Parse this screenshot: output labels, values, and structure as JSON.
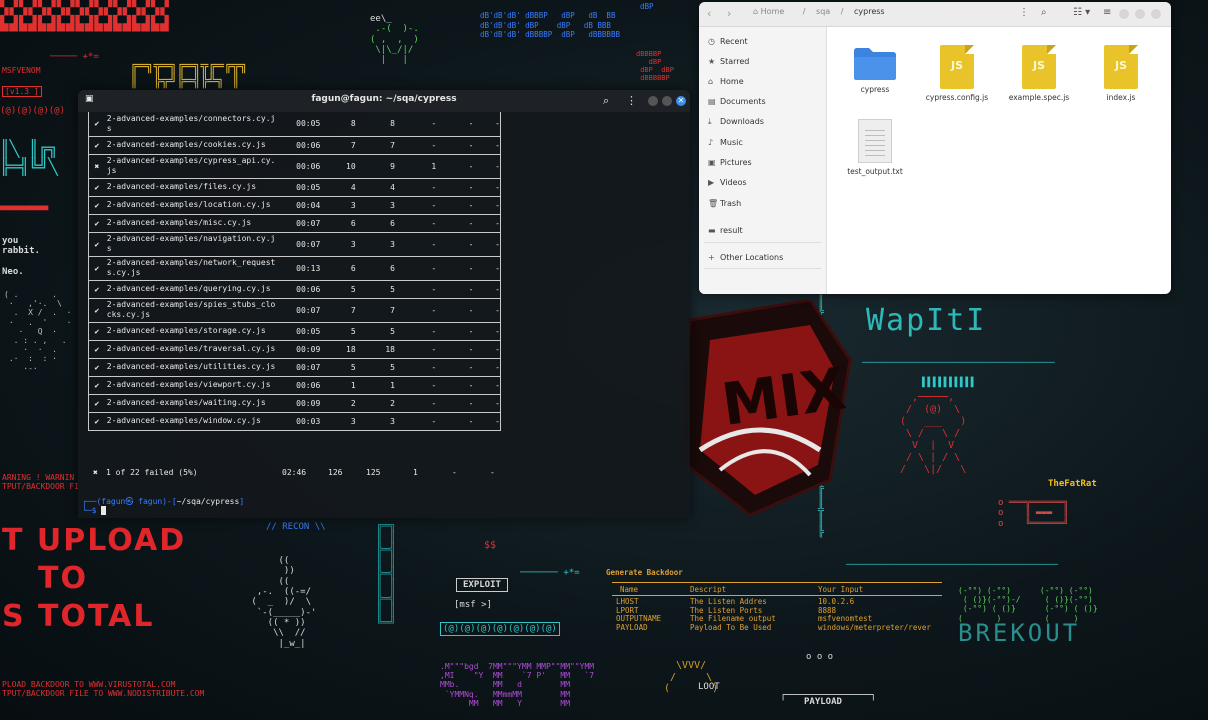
{
  "wallpaper": {
    "msfvenom_label": "MSFVENOM",
    "version_label": "[v1.3 ]",
    "rabbit_lines": [
      "you",
      "rabbit.",
      "",
      "Neo."
    ],
    "warning_lines": [
      "ARNING ! WARNIN",
      "TPUT/BACKDOOR FI"
    ],
    "upload_big": [
      "T UPLOAD",
      "TO",
      "S TOTAL"
    ],
    "upload_lines": [
      "PLOAD BACKDOOR TO WWW.VIRUSTOTAL.COM",
      "TPUT/BACKDOOR FILE TO WWW.NODISTRIBUTE.COM"
    ],
    "recon_label": "// RECON \\\\",
    "exploit_label": "EXPLOIT",
    "msf_label": "[msf >]",
    "at_line": "(@)(@)(@)(@)(@)(@)(@)",
    "money_label": "$$",
    "backdoor_title": "Generate Backdoor",
    "backdoor_table": {
      "headers": [
        "Name",
        "Descript",
        "Your Input"
      ],
      "rows": [
        [
          "LHOST",
          "The Listen Addres",
          "10.0.2.6"
        ],
        [
          "LPORT",
          "The Listen Ports",
          "8888"
        ],
        [
          "OUTPUTNAME",
          "The Filename output",
          "msfvenomtest"
        ],
        [
          "PAYLOAD",
          "Payload To Be Used",
          "windows/meterpreter/rever"
        ]
      ]
    },
    "fatrat_label": "TheFatRat",
    "loot_label": "LOOT",
    "payload_label": "PAYLOAD",
    "dots_label": "o o o",
    "matrix_lines": [
      ".M\"\"\"bgd  7MM\"\"\"YMM MMP\"\"MM\"\"YMM",
      ",MI    \"Y  MM    `7 P'   MM   `7",
      "MMb.       MM   d        MM",
      " `YMMNq.   MMmmMM        MM",
      "      MM   MM   Y        MM"
    ],
    "hex_lines": [
      "dBP",
      "dB'dB'dB' dBBBP   dBP   dB  BB",
      "dB'dB'dB' dBP    dBP   dB BBB",
      "dB'dB'dB' dBBBBP  dBP   dBBBBBB"
    ],
    "eel_label": "ee\\_"
  },
  "terminal": {
    "title": "fagun@fagun: ~/sqa/cypress",
    "rows": [
      {
        "status": "✔",
        "spec": "2-advanced-examples/connectors.cy.j\ns",
        "duration": "00:05",
        "tests": "8",
        "passing": "8",
        "failing": "-",
        "pending": "-",
        "skipped": "-"
      },
      {
        "status": "✔",
        "spec": "2-advanced-examples/cookies.cy.js",
        "duration": "00:06",
        "tests": "7",
        "passing": "7",
        "failing": "-",
        "pending": "-",
        "skipped": "-"
      },
      {
        "status": "✖",
        "spec": "2-advanced-examples/cypress_api.cy.\njs",
        "duration": "00:06",
        "tests": "10",
        "passing": "9",
        "failing": "1",
        "pending": "-",
        "skipped": "-"
      },
      {
        "status": "✔",
        "spec": "2-advanced-examples/files.cy.js",
        "duration": "00:05",
        "tests": "4",
        "passing": "4",
        "failing": "-",
        "pending": "-",
        "skipped": "-"
      },
      {
        "status": "✔",
        "spec": "2-advanced-examples/location.cy.js",
        "duration": "00:04",
        "tests": "3",
        "passing": "3",
        "failing": "-",
        "pending": "-",
        "skipped": "-"
      },
      {
        "status": "✔",
        "spec": "2-advanced-examples/misc.cy.js",
        "duration": "00:07",
        "tests": "6",
        "passing": "6",
        "failing": "-",
        "pending": "-",
        "skipped": "-"
      },
      {
        "status": "✔",
        "spec": "2-advanced-examples/navigation.cy.j\ns",
        "duration": "00:07",
        "tests": "3",
        "passing": "3",
        "failing": "-",
        "pending": "-",
        "skipped": "-"
      },
      {
        "status": "✔",
        "spec": "2-advanced-examples/network_request\ns.cy.js",
        "duration": "00:13",
        "tests": "6",
        "passing": "6",
        "failing": "-",
        "pending": "-",
        "skipped": "-"
      },
      {
        "status": "✔",
        "spec": "2-advanced-examples/querying.cy.js",
        "duration": "00:06",
        "tests": "5",
        "passing": "5",
        "failing": "-",
        "pending": "-",
        "skipped": "-"
      },
      {
        "status": "✔",
        "spec": "2-advanced-examples/spies_stubs_clo\ncks.cy.js",
        "duration": "00:07",
        "tests": "7",
        "passing": "7",
        "failing": "-",
        "pending": "-",
        "skipped": "-"
      },
      {
        "status": "✔",
        "spec": "2-advanced-examples/storage.cy.js",
        "duration": "00:05",
        "tests": "5",
        "passing": "5",
        "failing": "-",
        "pending": "-",
        "skipped": "-"
      },
      {
        "status": "✔",
        "spec": "2-advanced-examples/traversal.cy.js",
        "duration": "00:09",
        "tests": "18",
        "passing": "18",
        "failing": "-",
        "pending": "-",
        "skipped": "-"
      },
      {
        "status": "✔",
        "spec": "2-advanced-examples/utilities.cy.js",
        "duration": "00:07",
        "tests": "5",
        "passing": "5",
        "failing": "-",
        "pending": "-",
        "skipped": "-"
      },
      {
        "status": "✔",
        "spec": "2-advanced-examples/viewport.cy.js",
        "duration": "00:06",
        "tests": "1",
        "passing": "1",
        "failing": "-",
        "pending": "-",
        "skipped": "-"
      },
      {
        "status": "✔",
        "spec": "2-advanced-examples/waiting.cy.js",
        "duration": "00:09",
        "tests": "2",
        "passing": "2",
        "failing": "-",
        "pending": "-",
        "skipped": "-"
      },
      {
        "status": "✔",
        "spec": "2-advanced-examples/window.cy.js",
        "duration": "00:03",
        "tests": "3",
        "passing": "3",
        "failing": "-",
        "pending": "-",
        "skipped": "-"
      }
    ],
    "summary": {
      "status": "✖",
      "text": "1 of 22 failed (5%)",
      "duration": "02:46",
      "tests": "126",
      "passing": "125",
      "failing": "1",
      "pending": "-",
      "skipped": "-"
    },
    "prompt_user": "┌──(fagun㉿ fagun)-[",
    "prompt_path": "~/sqa/cypress",
    "prompt_end": "]",
    "prompt_line2": "└─$ "
  },
  "files": {
    "path": [
      "Home",
      "sqa",
      "cypress"
    ],
    "sidebar": [
      {
        "icon": "◷",
        "label": "Recent",
        "name": "recent"
      },
      {
        "icon": "★",
        "label": "Starred",
        "name": "starred"
      },
      {
        "icon": "⌂",
        "label": "Home",
        "name": "home"
      },
      {
        "icon": "▤",
        "label": "Documents",
        "name": "documents"
      },
      {
        "icon": "⤓",
        "label": "Downloads",
        "name": "downloads"
      },
      {
        "icon": "♪",
        "label": "Music",
        "name": "music"
      },
      {
        "icon": "▣",
        "label": "Pictures",
        "name": "pictures"
      },
      {
        "icon": "▶",
        "label": "Videos",
        "name": "videos"
      },
      {
        "icon": "🗑",
        "label": "Trash",
        "name": "trash"
      },
      {
        "icon": "▬",
        "label": "result",
        "name": "result"
      },
      {
        "icon": "+",
        "label": "Other Locations",
        "name": "other-locations"
      }
    ],
    "items": [
      {
        "name": "cypress",
        "type": "folder"
      },
      {
        "name": "cypress.config.js",
        "type": "js"
      },
      {
        "name": "example.spec.js",
        "type": "js"
      },
      {
        "name": "index.js",
        "type": "js"
      },
      {
        "name": "test_output.txt",
        "type": "txt"
      }
    ],
    "js_label": "JS",
    "folder_color": "#3b84e0"
  }
}
